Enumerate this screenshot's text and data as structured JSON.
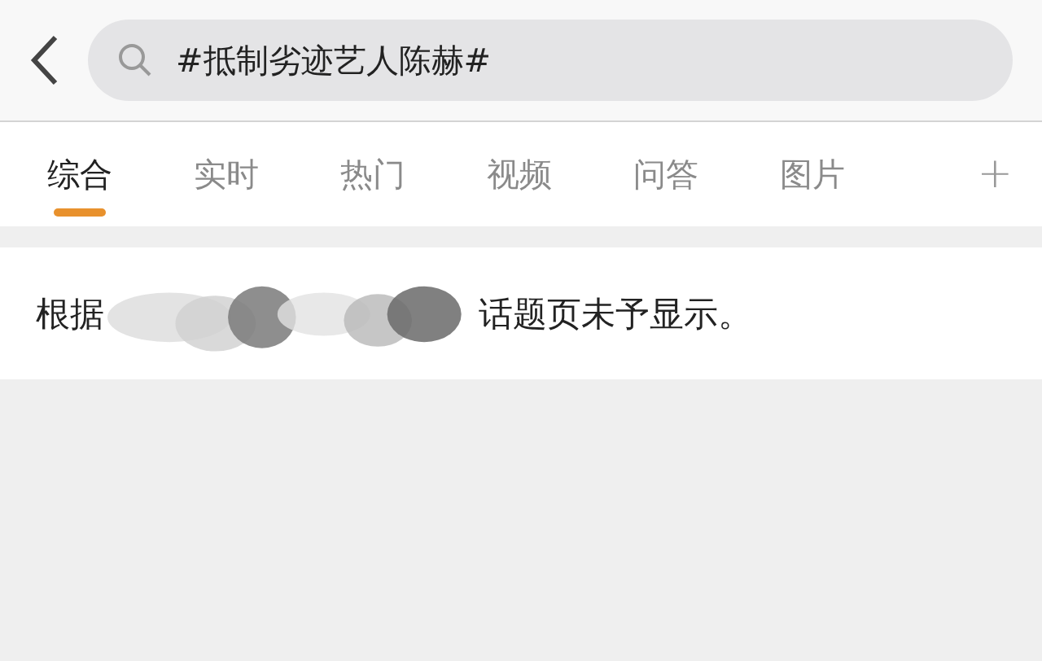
{
  "search": {
    "value": "#抵制劣迹艺人陈赫#"
  },
  "tabs": [
    {
      "label": "综合",
      "selected": true
    },
    {
      "label": "实时",
      "selected": false
    },
    {
      "label": "热门",
      "selected": false
    },
    {
      "label": "视频",
      "selected": false
    },
    {
      "label": "问答",
      "selected": false
    },
    {
      "label": "图片",
      "selected": false
    }
  ],
  "add_tab": "+",
  "notice": {
    "before": "根据",
    "after": "话题页未予显示。"
  }
}
